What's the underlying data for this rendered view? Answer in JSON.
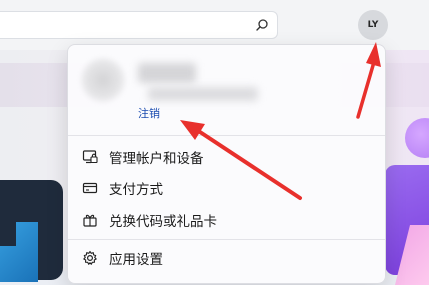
{
  "topbar": {
    "search": {
      "value": "",
      "placeholder": ""
    },
    "avatar_initials": "LY"
  },
  "menu": {
    "sign_out_label": "注销",
    "items": [
      {
        "label": "管理帐户和设备",
        "icon": "device-lock-icon"
      },
      {
        "label": "支付方式",
        "icon": "credit-card-icon"
      },
      {
        "label": "兑换代码或礼品卡",
        "icon": "gift-icon"
      },
      {
        "label": "应用设置",
        "icon": "gear-icon"
      }
    ]
  },
  "colors": {
    "accent_link": "#1a4bb0",
    "annotation_arrow": "#e8302c",
    "hero_purple": "#8a4fe6"
  }
}
